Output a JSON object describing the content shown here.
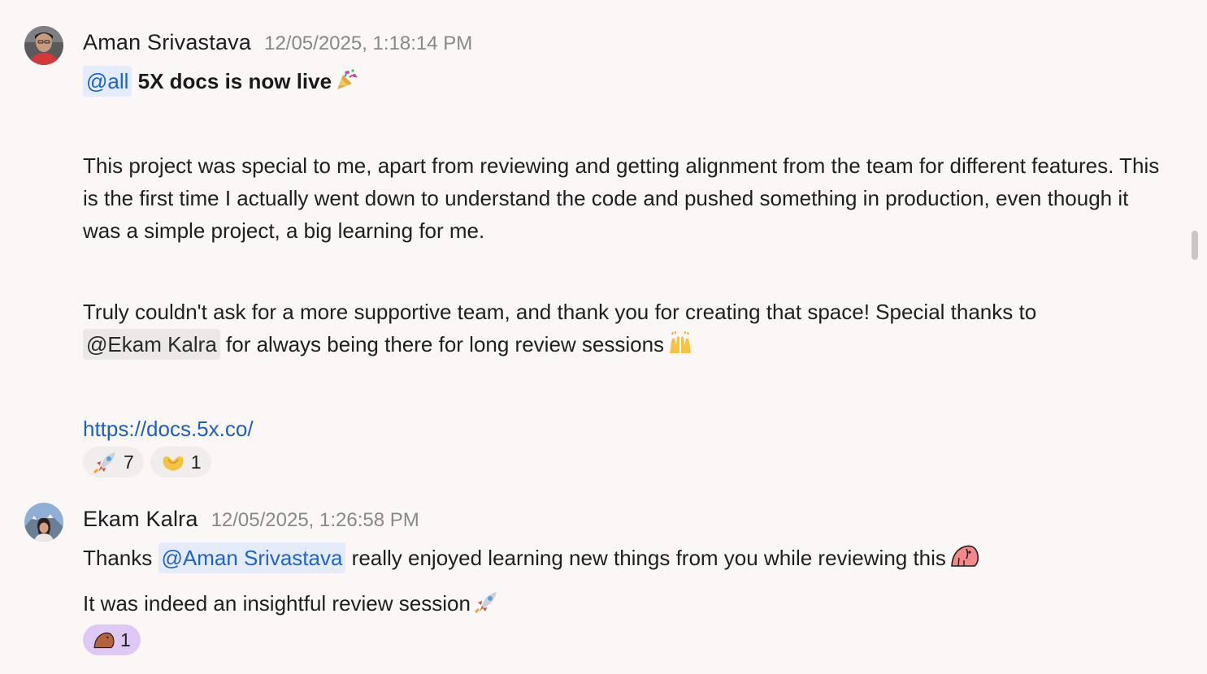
{
  "messages": [
    {
      "author": "Aman Srivastava",
      "timestamp": "12/05/2025, 1:18:14 PM",
      "avatar_icon": "person-avatar-red-shirt",
      "mention_all": "@all",
      "headline": "5X docs is now live",
      "headline_emoji": "party-popper-icon",
      "paragraph1": "This project was special to me, apart from reviewing and getting alignment from the team for different features. This is the first time I actually went down to understand the code and pushed something in production, even though it was a simple project, a big learning for me.",
      "paragraph2_start": "Truly couldn't ask for a more supportive team, and thank you for creating that space! Special thanks to",
      "mention_ekam": "@Ekam Kalra",
      "paragraph2_end": "for always being there for long review sessions",
      "paragraph2_emoji": "raising-hands-icon",
      "link": "https://docs.5x.co/",
      "reactions": [
        {
          "icon": "rocket-icon",
          "count": "7"
        },
        {
          "icon": "heart-hands-icon",
          "count": "1"
        }
      ]
    },
    {
      "author": "Ekam Kalra",
      "timestamp": "12/05/2025, 1:26:58 PM",
      "avatar_icon": "person-avatar-mountains",
      "line1_start": "Thanks",
      "mention_aman": "@Aman Srivastava",
      "line1_end": "really enjoyed learning new things from you while reviewing this",
      "line1_emoji": "bird-icon",
      "line2": "It was indeed an insightful review session",
      "line2_emoji": "rocket-icon",
      "reactions": [
        {
          "icon": "bird-icon",
          "count": "1"
        }
      ]
    }
  ],
  "colors": {
    "background": "#fbf7f6",
    "mention_blue_bg": "#e4ebfa",
    "mention_blue_text": "#1f64c8",
    "link": "#1f5fbf",
    "reaction_bg": "#f1edec",
    "reaction_active_bg": "#ddc9f3"
  }
}
